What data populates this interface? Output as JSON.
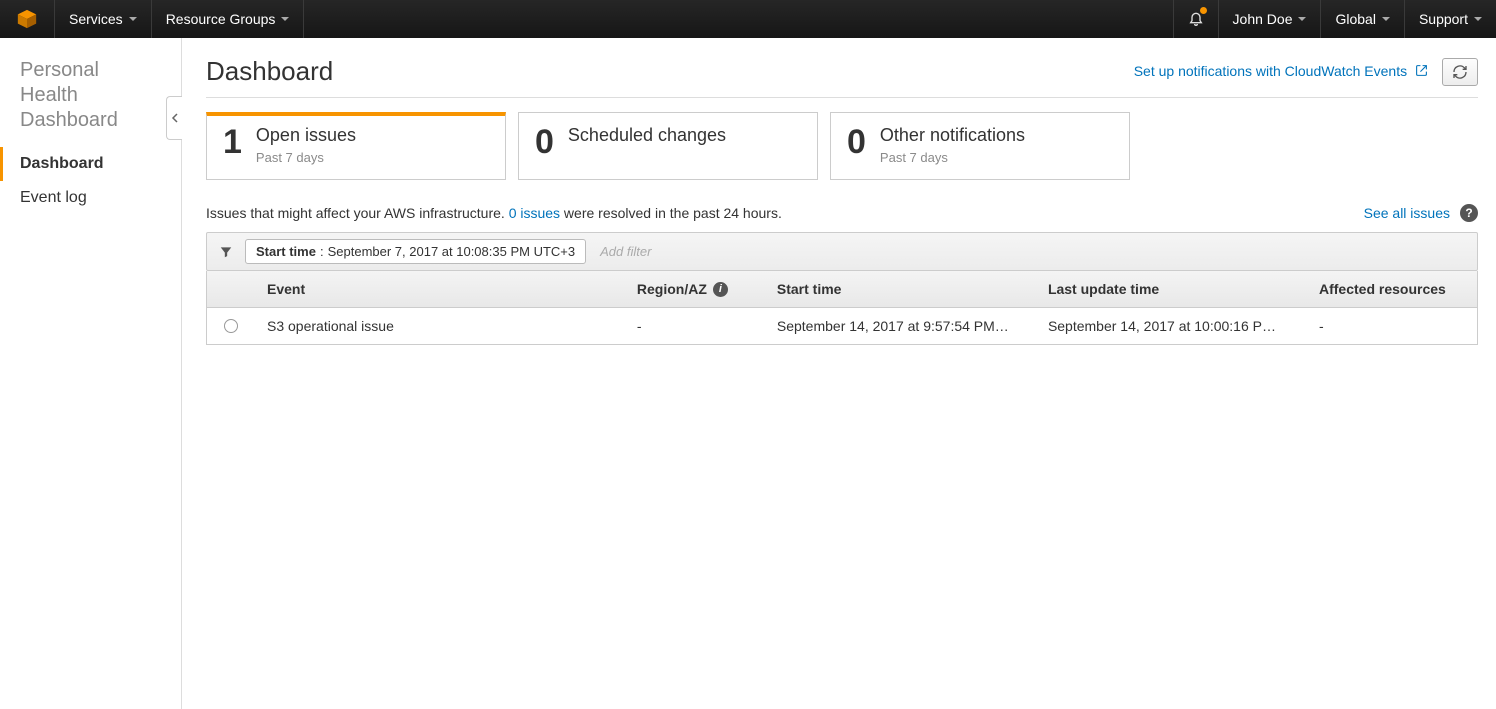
{
  "topnav": {
    "services": "Services",
    "resource_groups": "Resource Groups",
    "user": "John Doe",
    "region": "Global",
    "support": "Support"
  },
  "sidebar": {
    "title": "Personal Health Dashboard",
    "items": [
      {
        "label": "Dashboard",
        "active": true
      },
      {
        "label": "Event log",
        "active": false
      }
    ]
  },
  "header": {
    "title": "Dashboard",
    "notify_link": "Set up notifications with CloudWatch Events"
  },
  "cards": [
    {
      "count": "1",
      "label": "Open issues",
      "sub": "Past 7 days",
      "active": true
    },
    {
      "count": "0",
      "label": "Scheduled changes",
      "sub": "",
      "active": false
    },
    {
      "count": "0",
      "label": "Other notifications",
      "sub": "Past 7 days",
      "active": false
    }
  ],
  "desc": {
    "prefix": "Issues that might affect your AWS infrastructure. ",
    "link": "0 issues",
    "suffix": " were resolved in the past 24 hours.",
    "see_all": "See all issues"
  },
  "filter": {
    "label": "Start time",
    "value": "September 7, 2017 at 10:08:35 PM UTC+3",
    "add_placeholder": "Add filter"
  },
  "table": {
    "headers": {
      "event": "Event",
      "region": "Region/AZ",
      "start": "Start time",
      "update": "Last update time",
      "affected": "Affected resources"
    },
    "rows": [
      {
        "event": "S3 operational issue",
        "region": "-",
        "start": "September 14, 2017 at 9:57:54 PM…",
        "update": "September 14, 2017 at 10:00:16 P…",
        "affected": "-"
      }
    ]
  }
}
